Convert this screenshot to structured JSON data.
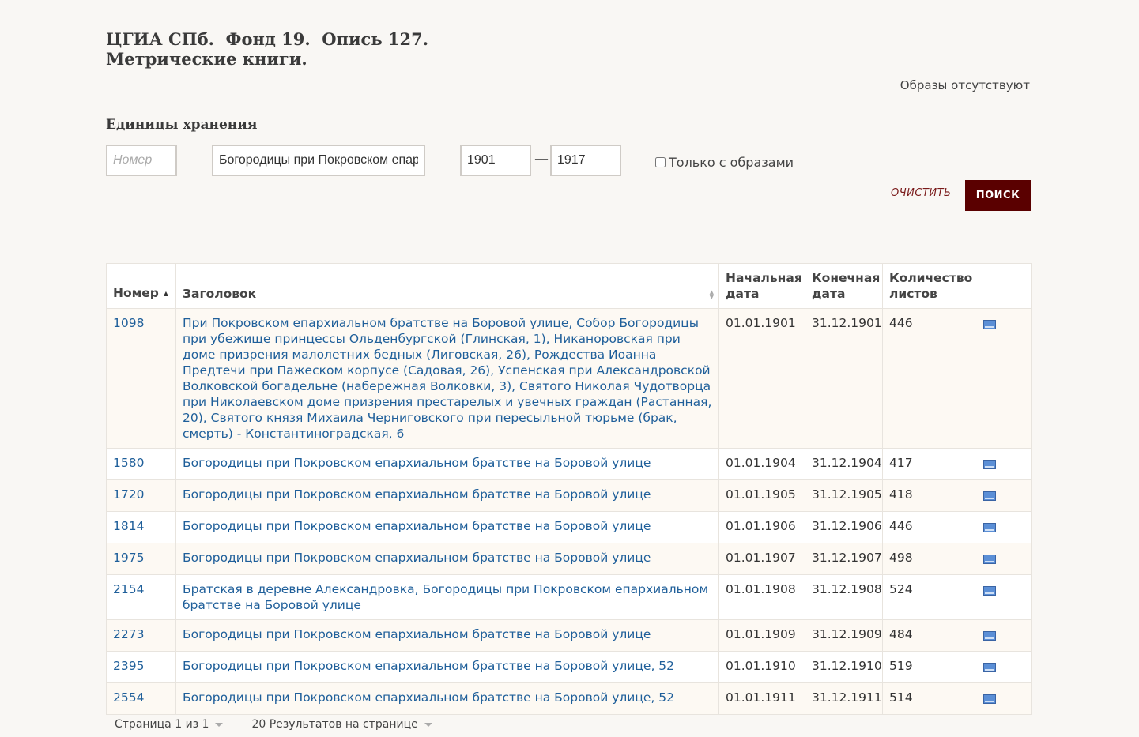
{
  "header": {
    "title_line1": "ЦГИА СПб.  Фонд 19.  Опись 127.",
    "title_line2": "Метрические книги.",
    "images_note": "Образы отсутствуют"
  },
  "filters": {
    "section_title": "Единицы хранения",
    "number_placeholder": "Номер",
    "title_value": "Богородицы при Покровском епар",
    "year_from": "1901",
    "year_to": "1917",
    "dash": "—",
    "only_images_label": "Только с образами",
    "clear_label": "ОЧИСТИТЬ",
    "search_label": "ПОИСК"
  },
  "table": {
    "columns": {
      "number": "Номер",
      "title": "Заголовок",
      "start_date_1": "Начальная",
      "start_date_2": "дата",
      "end_date_1": "Конечная",
      "end_date_2": "дата",
      "sheets_1": "Количество",
      "sheets_2": "листов"
    },
    "rows": [
      {
        "number": "1098",
        "title": "При Покровском епархиальном братстве на Боровой улице, Собор Богородицы при убежище принцессы Ольденбургской (Глинская, 1), Никаноровская при доме призрения малолетних бедных (Лиговская, 26), Рождества Иоанна Предтечи при Пажеском корпусе (Садовая, 26), Успенская при Александровской Волковской богадельне (набережная Волковки, 3), Святого Николая Чудотворца при Николаевском доме призрения престарелых и увечных граждан (Растанная, 20), Святого князя Михаила Черниговского при пересыльной тюрьме (брак, смерть) - Константиноградская, 6",
        "start": "01.01.1901",
        "end": "31.12.1901",
        "sheets": "446"
      },
      {
        "number": "1580",
        "title": "Богородицы при Покровском епархиальном братстве на Боровой улице",
        "start": "01.01.1904",
        "end": "31.12.1904",
        "sheets": "417"
      },
      {
        "number": "1720",
        "title": "Богородицы при Покровском епархиальном братстве на Боровой улице",
        "start": "01.01.1905",
        "end": "31.12.1905",
        "sheets": "418"
      },
      {
        "number": "1814",
        "title": "Богородицы при Покровском епархиальном братстве на Боровой улице",
        "start": "01.01.1906",
        "end": "31.12.1906",
        "sheets": "446"
      },
      {
        "number": "1975",
        "title": "Богородицы при Покровском епархиальном братстве на Боровой улице",
        "start": "01.01.1907",
        "end": "31.12.1907",
        "sheets": "498"
      },
      {
        "number": "2154",
        "title": "Братская в деревне Александровка, Богородицы при Покровском епархиальном братстве на Боровой улице",
        "start": "01.01.1908",
        "end": "31.12.1908",
        "sheets": "524"
      },
      {
        "number": "2273",
        "title": "Богородицы при Покровском епархиальном братстве на Боровой улице",
        "start": "01.01.1909",
        "end": "31.12.1909",
        "sheets": "484"
      },
      {
        "number": "2395",
        "title": "Богородицы при Покровском епархиальном братстве на Боровой улице, 52",
        "start": "01.01.1910",
        "end": "31.12.1910",
        "sheets": "519"
      },
      {
        "number": "2554",
        "title": "Богородицы при Покровском епархиальном братстве на Боровой улице, 52",
        "start": "01.01.1911",
        "end": "31.12.1911",
        "sheets": "514"
      }
    ],
    "row_icon": "image-icon"
  },
  "pager": {
    "page_label": "Страница 1 из 1",
    "per_page_label": "20 Результатов на странице"
  },
  "colors": {
    "accent": "#5a0000",
    "link": "#1f5f9a",
    "background": "#f9f7f4"
  }
}
